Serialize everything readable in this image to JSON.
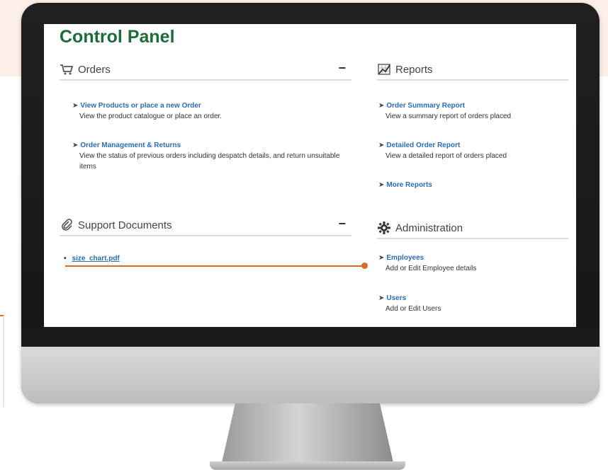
{
  "panel": {
    "title": "Control Panel",
    "orders": {
      "heading": "Orders",
      "collapse": "−",
      "items": [
        {
          "link": "View Products or place a new Order",
          "desc": "View the product catalogue or place an order."
        },
        {
          "link": "Order Management & Returns",
          "desc": "View the status of previous orders including despatch details, and return unsuitable items"
        }
      ]
    },
    "reports": {
      "heading": "Reports",
      "items": [
        {
          "link": "Order Summary Report",
          "desc": "View a summary report of orders placed"
        },
        {
          "link": "Detailed Order Report",
          "desc": "View a detailed report of orders placed"
        },
        {
          "link": "More Reports",
          "desc": ""
        }
      ]
    },
    "support": {
      "heading": "Support Documents",
      "collapse": "−",
      "files": [
        "size_chart.pdf"
      ]
    },
    "administration": {
      "heading": "Administration",
      "items": [
        {
          "link": "Employees",
          "desc": "Add or Edit Employee details"
        },
        {
          "link": "Users",
          "desc": "Add or Edit Users"
        }
      ]
    }
  },
  "colors": {
    "title_green": "#1e6b3a",
    "link_blue": "#2b6cb0",
    "callout_orange": "#d96a2a",
    "background_peach": "#fcefe7"
  },
  "icons": {
    "orders": "shopping-cart-icon",
    "reports": "chart-icon",
    "support": "paperclip-icon",
    "administration": "gear-icon",
    "item_arrow": "arrow-right-icon"
  }
}
